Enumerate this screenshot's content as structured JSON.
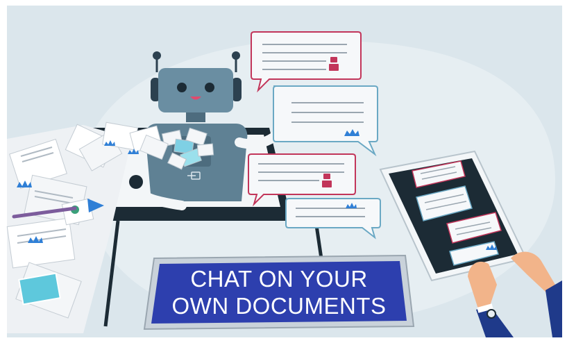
{
  "banner": {
    "line1": "CHAT ON YOUR",
    "line2": "OWN DOCUMENTS"
  },
  "colors": {
    "background": "#dbe6ec",
    "blob": "#e8eff3",
    "robot_body": "#5f8194",
    "robot_head": "#6a8ea2",
    "screen_dark": "#1c2b35",
    "banner_blue": "#2d3fae",
    "banner_frame": "#c9d2da",
    "bubble_robot_border": "#c2355a",
    "bubble_user_border": "#6aa8c4",
    "bubble_line": "#9aa6b0",
    "crown_blue": "#2f7fd6",
    "paper": "#f4f6f8"
  },
  "icons": [
    "robot-icon",
    "crown-icon",
    "document-icon",
    "hand-icon",
    "watch-icon",
    "login-icon"
  ]
}
